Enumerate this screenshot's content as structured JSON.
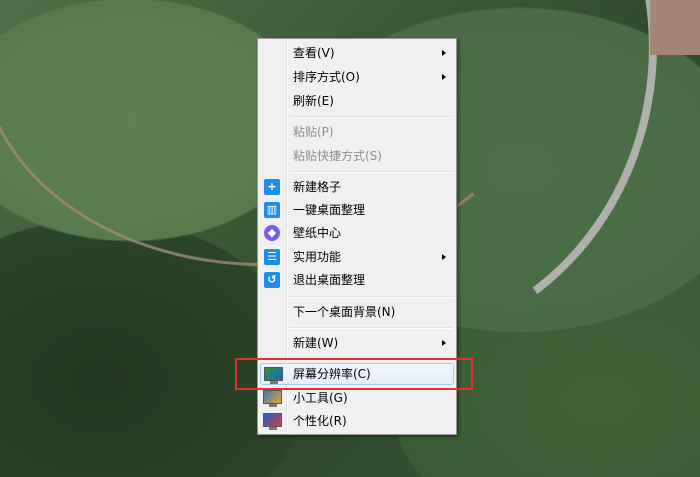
{
  "menu": {
    "view": "查看(V)",
    "sort": "排序方式(O)",
    "refresh": "刷新(E)",
    "paste": "粘贴(P)",
    "paste_shortcut": "粘贴快捷方式(S)",
    "new_grid": "新建格子",
    "one_key": "一键桌面整理",
    "wallpaper": "壁纸中心",
    "tools": "实用功能",
    "exit_organize": "退出桌面整理",
    "next_bg": "下一个桌面背景(N)",
    "new": "新建(W)",
    "resolution": "屏幕分辨率(C)",
    "gadgets": "小工具(G)",
    "personalize": "个性化(R)"
  },
  "highlight_color": "#e53030"
}
